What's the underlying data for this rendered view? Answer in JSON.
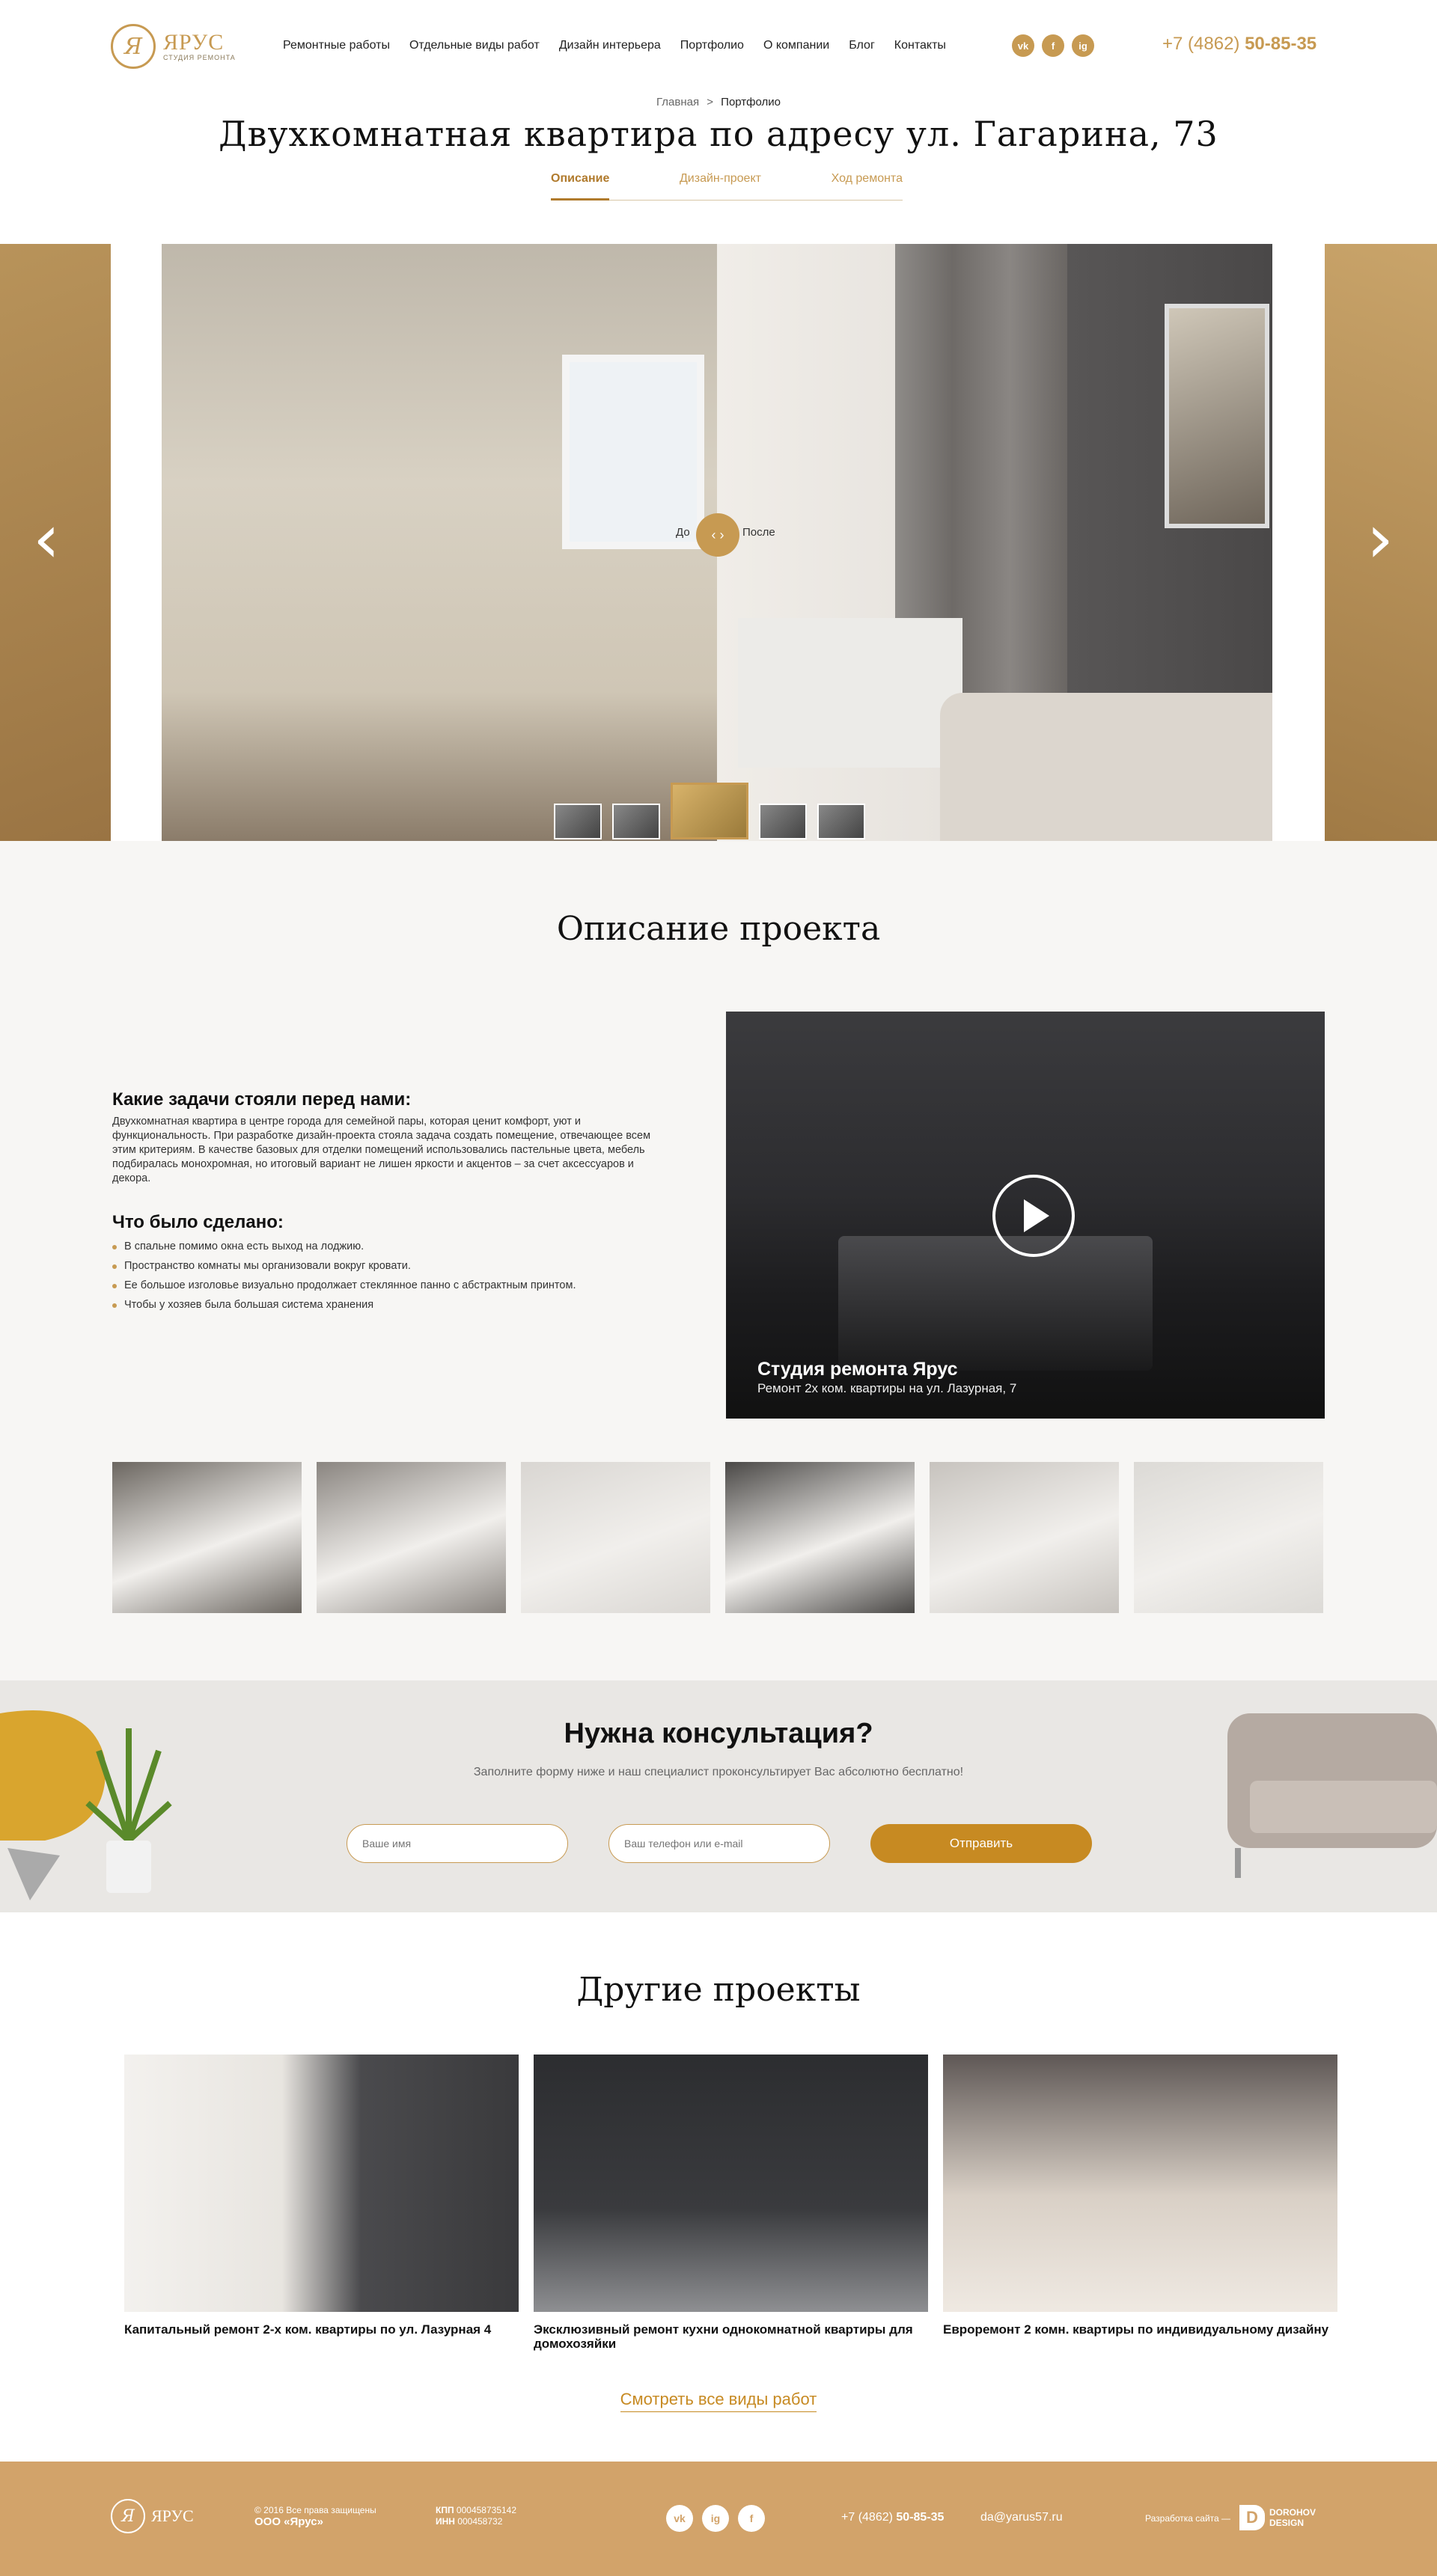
{
  "header": {
    "logo_mark": "Я",
    "logo_name": "ЯРУС",
    "logo_sub": "СТУДИЯ РЕМОНТА",
    "nav": [
      "Ремонтные работы",
      "Отдельные виды работ",
      "Дизайн интерьера",
      "Портфолио",
      "О компании",
      "Блог",
      "Контакты"
    ],
    "socials": [
      "vk",
      "f",
      "ig"
    ],
    "phone_prefix": "+7 (4862)",
    "phone_number": "50-85-35"
  },
  "breadcrumb": {
    "home": "Главная",
    "sep": ">",
    "current": "Портфолио"
  },
  "page_title": "Двухкомнатная квартира по адресу ул. Гагарина, 73",
  "tabs": [
    "Описание",
    "Дизайн-проект",
    "Ход ремонта"
  ],
  "slider": {
    "before_label": "До",
    "after_label": "После",
    "thumb_count": 5,
    "active_thumb": 2
  },
  "description": {
    "heading": "Описание проекта",
    "tasks_heading": "Какие задачи стояли перед нами:",
    "tasks_text": "Двухкомнатная квартира в центре города для семейной пары, которая ценит комфорт, уют и функциональность. При разработке дизайн-проекта стояла задача создать помещение, отвечающее всем этим критериям. В качестве базовых для отделки помещений использовались пастельные цвета, мебель подбиралась монохромная, но итоговый вариант не лишен яркости и акцентов – за счет аксессуаров и декора.",
    "done_heading": "Что было сделано:",
    "done_items": [
      "В спальне помимо окна есть выход на лоджию.",
      "Пространство комнаты мы организовали вокруг кровати.",
      "Ее большое изголовье визуально продолжает стеклянное панно с абстрактным принтом.",
      "Чтобы у хозяев была большая система хранения"
    ],
    "video_title": "Студия ремонта Ярус",
    "video_subtitle": "Ремонт 2х ком. квартиры на ул. Лазурная, 7"
  },
  "gallery_colors": [
    "#6b6660",
    "#8a8580",
    "#d9d6d2",
    "#4a4846",
    "#c7c3be",
    "#dcdad6"
  ],
  "consult": {
    "heading": "Нужна консультация?",
    "text": "Заполните форму ниже и наш специалист проконсультирует Вас абсолютно бесплатно!",
    "name_placeholder": "Ваше имя",
    "contact_placeholder": "Ваш телефон или e-mail",
    "submit": "Отправить"
  },
  "other": {
    "heading": "Другие проекты",
    "projects": [
      {
        "title": "Капитальный ремонт 2-х ком. квартиры по ул. Лазурная 4"
      },
      {
        "title": "Эксклюзивный ремонт кухни однокомнатной квартиры для домохозяйки"
      },
      {
        "title": "Евроремонт 2 комн. квартиры по индивидуальному дизайну"
      }
    ],
    "see_all": "Смотреть все виды работ"
  },
  "footer": {
    "logo_name": "ЯРУС",
    "copyright": "© 2016 Все права защищены",
    "company": "ООО «Ярус»",
    "kpp_label": "КПП",
    "kpp": "000458735142",
    "inn_label": "ИНН",
    "inn": "000458732",
    "phone_prefix": "+7 (4862)",
    "phone_number": "50-85-35",
    "email": "da@yarus57.ru",
    "dev_label": "Разработка сайта —",
    "dev_name": "DOROHOV",
    "dev_name2": "DESIGN"
  },
  "colors": {
    "accent": "#c79a52",
    "button": "#c78a22",
    "footer": "#d2a36a"
  }
}
